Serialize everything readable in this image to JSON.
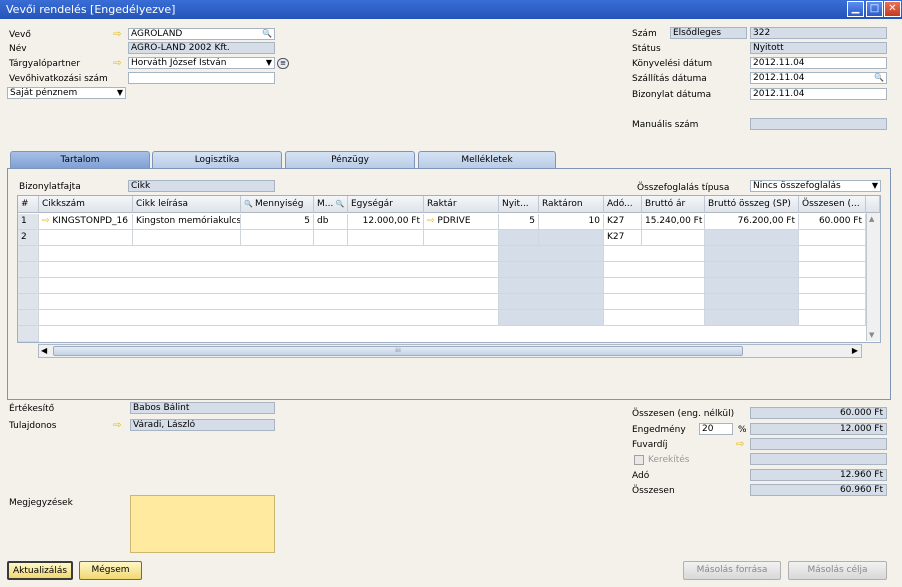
{
  "window": {
    "title": "Vevői rendelés [Engedélyezve]"
  },
  "header": {
    "customer_label": "Vevő",
    "customer_value": "AGROLAND",
    "name_label": "Név",
    "name_value": "AGRO-LAND 2002 Kft.",
    "contact_label": "Tárgyalópartner",
    "contact_value": "Horváth József István",
    "ref_label": "Vevőhivatkozási szám",
    "ref_value": "",
    "currency_value": "Saját pénznem",
    "number_label": "Szám",
    "series_value": "Elsődleges",
    "number_value": "322",
    "status_label": "Státus",
    "status_value": "Nyitott",
    "posting_label": "Könyvelési dátum",
    "posting_value": "2012.11.04",
    "delivery_label": "Szállítás dátuma",
    "delivery_value": "2012.11.04",
    "docdate_label": "Bizonylat dátuma",
    "docdate_value": "2012.11.04",
    "manual_label": "Manuális szám",
    "manual_value": ""
  },
  "tabs": [
    {
      "label": "Tartalom"
    },
    {
      "label": "Logisztika"
    },
    {
      "label": "Pénzügy"
    },
    {
      "label": "Mellékletek"
    }
  ],
  "content": {
    "doctype_label": "Bizonylatfajta",
    "doctype_value": "Cikk",
    "summary_label": "Összefoglalás típusa",
    "summary_value": "Nincs összefoglalás"
  },
  "grid": {
    "headers": [
      "#",
      "Cikkszám",
      "Cikk leírása",
      "Mennyiség",
      "M...",
      "Egységár",
      "Raktár",
      "Nyit...",
      "Raktáron",
      "Adó...",
      "Bruttó ár",
      "Bruttó összeg (SP)",
      "Összesen (..."
    ],
    "row1": [
      "1",
      "KINGSTONPD_16",
      "Kingston memóriakulcs",
      "5",
      "db",
      "12.000,00 Ft",
      "PDRIVE",
      "5",
      "10",
      "K27",
      "15.240,00 Ft",
      "76.200,00 Ft",
      "60.000 Ft"
    ],
    "row2": [
      "2",
      "K27"
    ]
  },
  "footer": {
    "sales_label": "Értékesítő",
    "sales_value": "Babos Bálint",
    "owner_label": "Tulajdonos",
    "owner_value": "Váradi, László",
    "remarks_label": "Megjegyzések",
    "total_before_label": "Összesen (eng. nélkül)",
    "total_before_value": "60.000 Ft",
    "discount_label": "Engedmény",
    "discount_pct": "20",
    "pct_sign": "%",
    "discount_value": "12.000 Ft",
    "freight_label": "Fuvardíj",
    "freight_value": "",
    "rounding_label": "Kerekítés",
    "tax_label": "Adó",
    "tax_value": "12.960 Ft",
    "total_label": "Összesen",
    "total_value": "60.960 Ft"
  },
  "buttons": {
    "update": "Aktualizálás",
    "cancel": "Mégsem",
    "copy_from": "Másolás forrása",
    "copy_to": "Másolás célja"
  }
}
